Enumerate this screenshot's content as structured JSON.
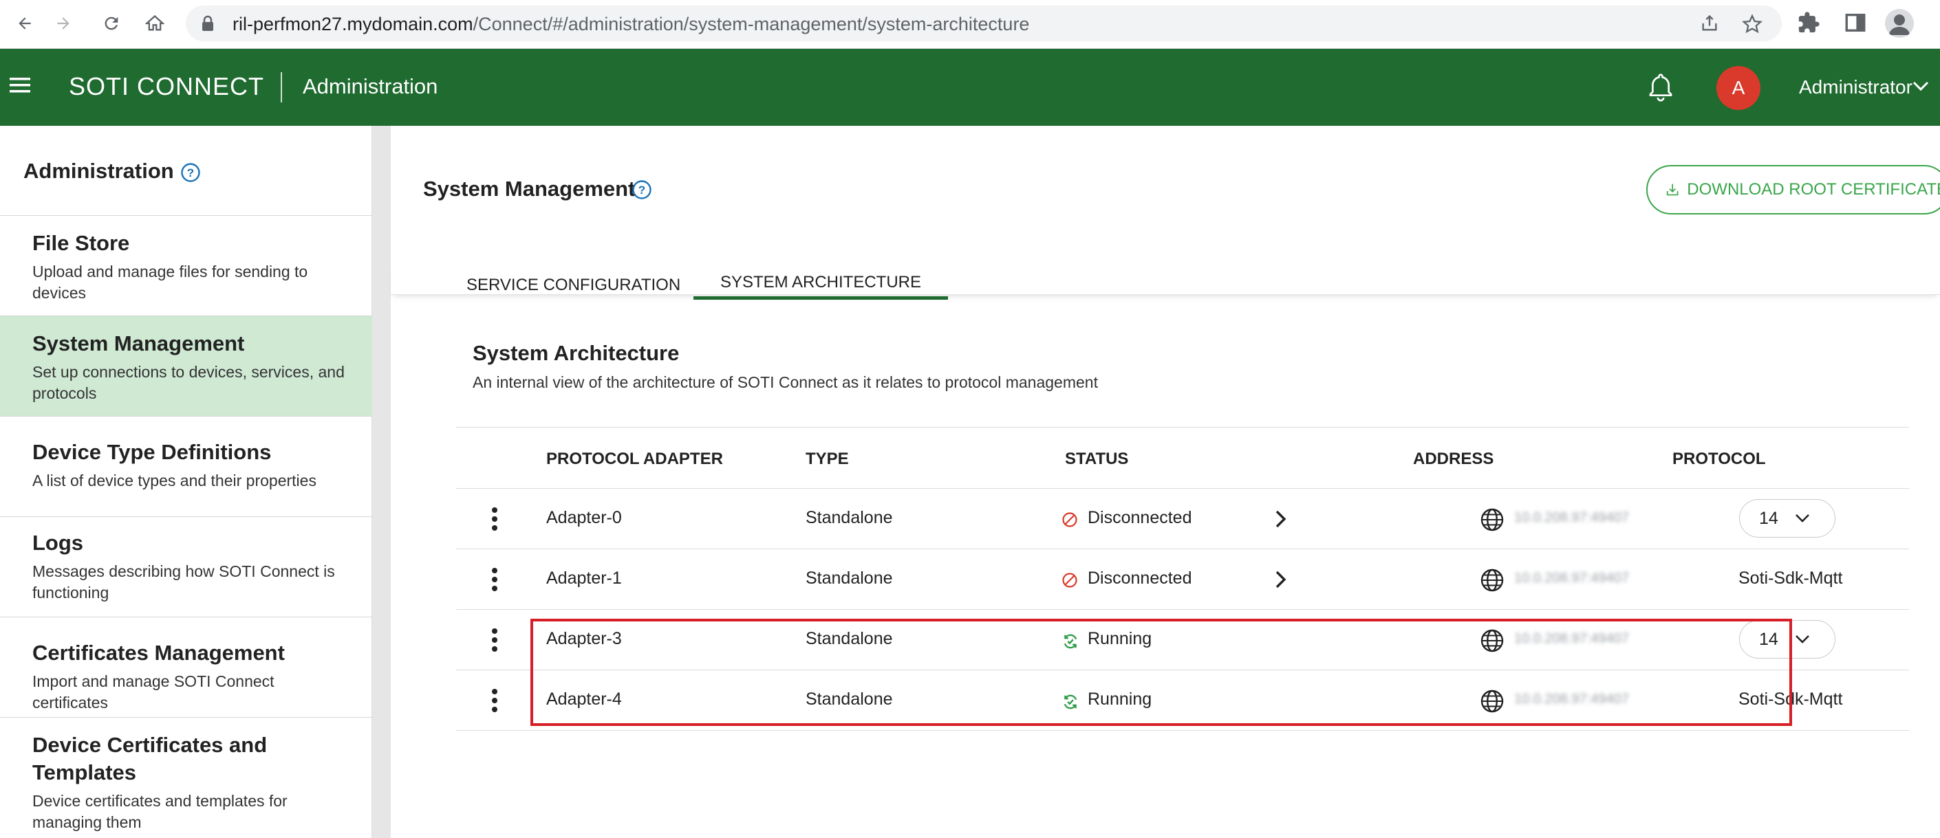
{
  "browser": {
    "url_host": "ril-perfmon27.mydomain.com",
    "url_path": "/Connect/#/administration/system-management/system-architecture"
  },
  "header": {
    "brand": "SOTI CONNECT",
    "section": "Administration",
    "avatar_initial": "A",
    "user_name": "Administrator",
    "brand_color": "#1f6b30"
  },
  "sidebar": {
    "title": "Administration",
    "items": [
      {
        "title": "File Store",
        "desc": "Upload and manage files for sending to devices"
      },
      {
        "title": "System Management",
        "desc": "Set up connections to devices, services, and protocols"
      },
      {
        "title": "Device Type Definitions",
        "desc": "A list of device types and their properties"
      },
      {
        "title": "Logs",
        "desc": "Messages describing how SOTI Connect is functioning"
      },
      {
        "title": "Certificates Management",
        "desc": "Import and manage SOTI Connect certificates"
      },
      {
        "title": "Device Certificates and Templates",
        "desc": "Device certificates and templates for managing them"
      }
    ]
  },
  "main": {
    "title": "System Management",
    "download_button": "DOWNLOAD ROOT CERTIFICATE",
    "tabs": [
      {
        "label": "SERVICE CONFIGURATION"
      },
      {
        "label": "SYSTEM ARCHITECTURE"
      }
    ],
    "card_title": "System Architecture",
    "card_desc": "An internal view of the architecture of SOTI Connect as it relates to protocol management",
    "columns": [
      "PROTOCOL ADAPTER",
      "TYPE",
      "STATUS",
      "ADDRESS",
      "PROTOCOL"
    ],
    "rows": [
      {
        "adapter": "Adapter-0",
        "type": "Standalone",
        "status": "Disconnected",
        "address": "10.0.208.97:49407",
        "protocol": "14"
      },
      {
        "adapter": "Adapter-1",
        "type": "Standalone",
        "status": "Disconnected",
        "address": "10.0.208.97:49407",
        "protocol": "Soti-Sdk-Mqtt"
      },
      {
        "adapter": "Adapter-3",
        "type": "Standalone",
        "status": "Running",
        "address": "10.0.208.97:49407",
        "protocol": "14"
      },
      {
        "adapter": "Adapter-4",
        "type": "Standalone",
        "status": "Running",
        "address": "10.0.208.97:49407",
        "protocol": "Soti-Sdk-Mqtt"
      }
    ]
  }
}
